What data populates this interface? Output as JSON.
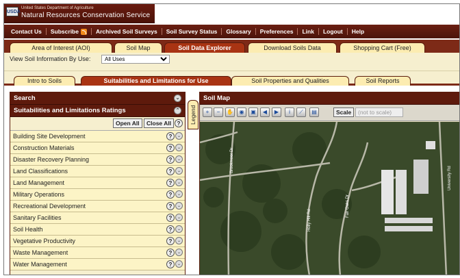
{
  "banner": {
    "dept": "United States Department of Agriculture",
    "agency": "Natural Resources Conservation Service",
    "logo": "USDA"
  },
  "topnav": [
    "Contact Us",
    "Subscribe",
    "Archived Soil Surveys",
    "Soil Survey Status",
    "Glossary",
    "Preferences",
    "Link",
    "Logout",
    "Help"
  ],
  "tabs": [
    "Area of Interest (AOI)",
    "Soil Map",
    "Soil Data Explorer",
    "Download Soils Data",
    "Shopping Cart (Free)"
  ],
  "view": {
    "label": "View Soil Information By Use:",
    "value": "All Uses"
  },
  "subtabs": [
    "Intro to Soils",
    "Suitabilities and Limitations for Use",
    "Soil Properties and Qualities",
    "Soil Reports"
  ],
  "left": {
    "search_title": "Search",
    "ratings_title": "Suitabilities and Limitations Ratings",
    "open_all": "Open All",
    "close_all": "Close All",
    "items": [
      "Building Site Development",
      "Construction Materials",
      "Disaster Recovery Planning",
      "Land Classifications",
      "Land Management",
      "Military Operations",
      "Recreational Development",
      "Sanitary Facilities",
      "Soil Health",
      "Vegetative Productivity",
      "Waste Management",
      "Water Management"
    ]
  },
  "legend_tab": "Legend",
  "map": {
    "title": "Soil Map",
    "scale_label": "Scale",
    "scale_value": "(not to scale)",
    "road_labels": [
      "Brookmoor Dr",
      "Holly Hill Rd",
      "Fair Oaks Dr",
      "University Rd"
    ]
  },
  "colors": {
    "header": "#5e1a0c",
    "tab_active": "#a93413",
    "tab": "#fcecb1",
    "panel_bg": "#f6efcf"
  }
}
